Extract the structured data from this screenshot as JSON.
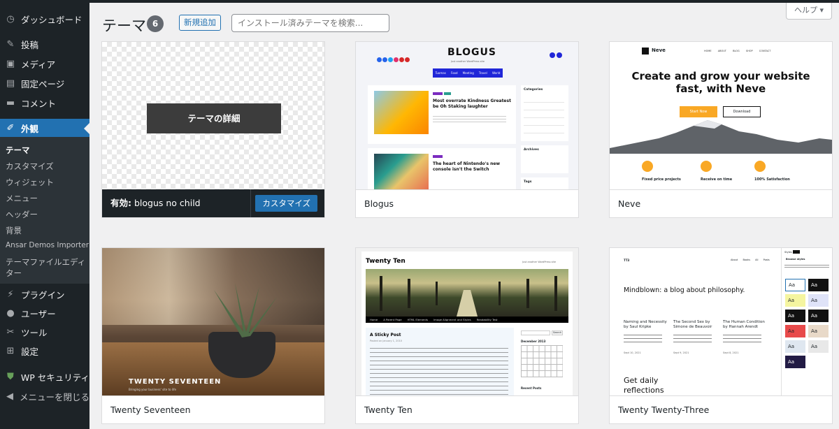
{
  "sidebar": {
    "dashboard": "ダッシュボード",
    "posts": "投稿",
    "media": "メディア",
    "pages": "固定ページ",
    "comments": "コメント",
    "appearance": "外観",
    "sub": {
      "themes": "テーマ",
      "customize": "カスタマイズ",
      "widgets": "ウィジェット",
      "menus": "メニュー",
      "header": "ヘッダー",
      "background": "背景",
      "ansar": "Ansar Demos Importer",
      "theme_editor_1": "テーマファイルエディ",
      "theme_editor_2": "ター"
    },
    "plugins": "プラグイン",
    "users": "ユーザー",
    "tools": "ツール",
    "settings": "設定",
    "security": "WP セキュリティ",
    "collapse": "メニューを閉じる"
  },
  "header": {
    "title": "テーマ",
    "count": "6",
    "add_new": "新規追加",
    "search_placeholder": "インストール済みテーマを検索...",
    "help": "ヘルプ ▾"
  },
  "themes": [
    {
      "name": "blogus no child",
      "active": true,
      "active_label": "有効:",
      "details": "テーマの詳細",
      "customize": "カスタマイズ"
    },
    {
      "name": "Blogus"
    },
    {
      "name": "Neve"
    },
    {
      "name": "Twenty Seventeen"
    },
    {
      "name": "Twenty Ten"
    },
    {
      "name": "Twenty Twenty-Three"
    }
  ],
  "previews": {
    "blogus": {
      "logo": "BLOGUS",
      "tagline": "Just another WordPress site",
      "nav": [
        "Tuomas",
        "Food",
        "Meeting",
        "Travel",
        "World"
      ],
      "post1": "Most overrate Kindness Greatest be Oh Staking laughter",
      "post2": "The heart of Nintendo's new console isn't the Switch",
      "widgets": [
        "Categories",
        "Archives",
        "Tags"
      ]
    },
    "neve": {
      "logo": "Neve",
      "nav": [
        "HOME",
        "ABOUT",
        "BLOG",
        "SHOP",
        "CONTACT"
      ],
      "headline": "Create and grow your website fast, with Neve",
      "btn1": "Start Now",
      "btn2": "Download",
      "features": [
        "Fixed price projects",
        "Receive on time",
        "100% Satisfaction"
      ]
    },
    "seventeen": {
      "title": "TWENTY SEVENTEEN",
      "tagline": "Bringing your business' site to life"
    },
    "ten": {
      "title": "Twenty Ten",
      "tagline": "Just another WordPress site",
      "nav": [
        "Home",
        "A Parent Page",
        "HTML Elements",
        "Image Alignment and Styles",
        "Readability Test"
      ],
      "post_title": "A Sticky Post",
      "post_meta": "Posted on January 1, 2010",
      "calendar": "December 2013",
      "search": "Search",
      "recent": "Recent Posts"
    },
    "tt3": {
      "logo": "TT3",
      "nav": [
        "About",
        "Books",
        "All Posts"
      ],
      "headline": "Mindblown: a blog about philosophy.",
      "posts": [
        {
          "title": "Naming and Necessity by Saul Kripke",
          "date": "Sept 10, 2021"
        },
        {
          "title": "The Second Sex by Simone de Beauvoir",
          "date": "Sept 9, 2021"
        },
        {
          "title": "The Human Condition by Hannah Arendt",
          "date": "Sept 8, 2021"
        }
      ],
      "footer_text": "Get daily reflections",
      "styles_tab": "Styles",
      "styles_label": "Browse styles",
      "aa": "Aa"
    }
  }
}
